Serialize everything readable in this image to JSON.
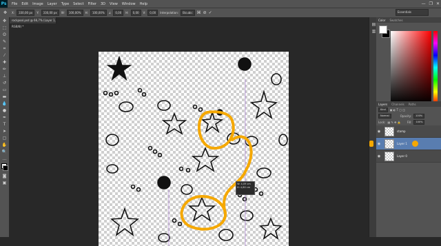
{
  "app": {
    "logo": "Ps"
  },
  "menu": [
    "File",
    "Edit",
    "Image",
    "Layer",
    "Type",
    "Select",
    "Filter",
    "3D",
    "View",
    "Window",
    "Help"
  ],
  "window_controls": [
    "—",
    "❐",
    "✕"
  ],
  "options_bar": {
    "x_value": "330,00 px",
    "y_value": "330,00 px",
    "w_value": "100,00%",
    "h_value": "100,00%",
    "angle_value": "0,00",
    "h_skew_value": "0,00",
    "v_skew_value": "0,00",
    "interpolation_label": "Interpolation:",
    "interpolation_value": "Bicubic",
    "workspace": "Essentials"
  },
  "document": {
    "tab_title": "rockpool.psd @ 66,7% (Layer 1, RGB/8) *",
    "transform_readout_w": "W: 4,09 cm",
    "transform_readout_h": "H: 4,80 cm"
  },
  "color_panel": {
    "tabs": [
      "Color",
      "Swatches"
    ]
  },
  "layers_panel": {
    "tabs": [
      "Layers",
      "Channels",
      "Paths"
    ],
    "kind_label": "Kind",
    "blend_mode": "Normal",
    "opacity_label": "Opacity:",
    "opacity_value": "100%",
    "lock_label": "Lock:",
    "fill_label": "Fill:",
    "fill_value": "100%",
    "layers": [
      {
        "name": "stamp",
        "selected": false
      },
      {
        "name": "Layer 1",
        "selected": true
      },
      {
        "name": "Layer 0",
        "selected": false
      }
    ]
  },
  "annotation_color": "#f5a800"
}
